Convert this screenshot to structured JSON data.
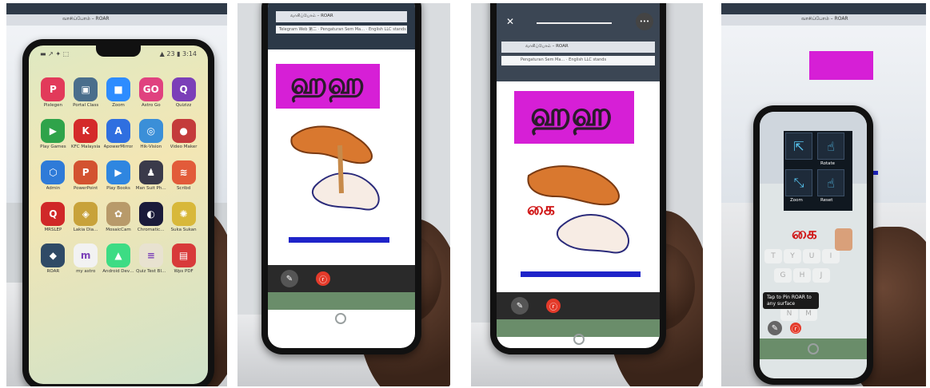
{
  "photos": [
    {
      "status_left": "▬ ↗ ✦ ⬚",
      "status_right": "▲ 23 ▮ 3:14",
      "browser_tab": "வாசிப்போம் – ROAR",
      "apps": [
        {
          "label": "Pixlegen",
          "color": "#e23a5a",
          "glyph": "P"
        },
        {
          "label": "Portal Class",
          "color": "#4a6e8c",
          "glyph": "▣"
        },
        {
          "label": "Zoom",
          "color": "#2d8cff",
          "glyph": "■"
        },
        {
          "label": "Astro Go",
          "color": "#e0427f",
          "glyph": "GO"
        },
        {
          "label": "Quizizz",
          "color": "#7b3fb8",
          "glyph": "Q"
        },
        {
          "label": "Play Games",
          "color": "#2fa34a",
          "glyph": "▶"
        },
        {
          "label": "KFC Malaysia",
          "color": "#d42a2a",
          "glyph": "K"
        },
        {
          "label": "ApowerMirror",
          "color": "#2f6fe0",
          "glyph": "A"
        },
        {
          "label": "Hik-Vision",
          "color": "#3b8fd8",
          "glyph": "◎"
        },
        {
          "label": "Video Maker",
          "color": "#c43b3b",
          "glyph": "●"
        },
        {
          "label": "Admin",
          "color": "#2f7bd8",
          "glyph": "⬡"
        },
        {
          "label": "PowerPoint",
          "color": "#d35230",
          "glyph": "P"
        },
        {
          "label": "Play Books",
          "color": "#2f86e0",
          "glyph": "▶"
        },
        {
          "label": "Man Suit Ph…",
          "color": "#3a3a4a",
          "glyph": "♟"
        },
        {
          "label": "Scribd",
          "color": "#e25b3a",
          "glyph": "≋"
        },
        {
          "label": "MRSLEP",
          "color": "#d02828",
          "glyph": "Q"
        },
        {
          "label": "Lakia Dia…",
          "color": "#c8a23a",
          "glyph": "◈"
        },
        {
          "label": "MosaicCam",
          "color": "#b89a6a",
          "glyph": "✿"
        },
        {
          "label": "Chromatic…",
          "color": "#1a1a3a",
          "glyph": "◐"
        },
        {
          "label": "Suka Sukan",
          "color": "#d8b83a",
          "glyph": "✺"
        },
        {
          "label": "ROAR",
          "color": "#2f4a66",
          "glyph": "◆"
        },
        {
          "label": "my astro",
          "color": "#f2f2f2",
          "glyph": "m"
        },
        {
          "label": "Android Dev…",
          "color": "#3ddc84",
          "glyph": "▲"
        },
        {
          "label": "Quiz Test Bl…",
          "color": "#e8e2d0",
          "glyph": "≡"
        },
        {
          "label": "Wps PDF",
          "color": "#d83a3a",
          "glyph": "▤"
        }
      ]
    },
    {
      "browser_tab": "வாசிப்போம் – ROAR",
      "bookmarks": "Telegram Web 第二 · Pengaturan Sem Ma… · English LLC stands",
      "title_glyph": "ஹஹ",
      "ar_button": "ⓡ"
    },
    {
      "close_icon": "✕",
      "more_icon": "•••",
      "browser_tab": "வாசிப்போம் – ROAR",
      "bookmarks": "Pengaturan Sem Ma… · English LLC stands",
      "title_glyph": "ஹஹ",
      "tamil_word": "கை",
      "ar_button": "ⓡ"
    },
    {
      "browser_tab": "வாசிப்போம் – ROAR",
      "menu": [
        {
          "label": "Rotate"
        },
        {
          "label": "Zoom"
        },
        {
          "label": "Reset"
        }
      ],
      "tamil_word": "கை",
      "tooltip": "Tap to Pin ROAR to any surface",
      "ar_button": "ⓡ",
      "keys": [
        "T",
        "Y",
        "U",
        "I",
        "G",
        "H",
        "J",
        "N",
        "M"
      ]
    }
  ]
}
